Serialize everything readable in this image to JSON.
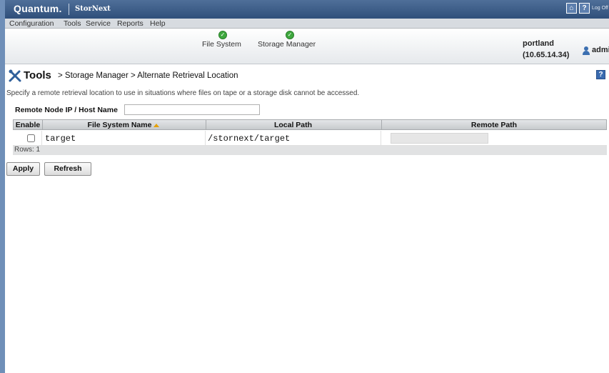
{
  "topbar": {
    "brand": "Quantum.",
    "product": "StorNext",
    "home_icon": "home-icon",
    "help_icon": "help-icon",
    "logoff_label": "Log Off"
  },
  "menu": {
    "items": [
      "Configuration",
      "Tools",
      "Service",
      "Reports",
      "Help"
    ]
  },
  "status": {
    "items": [
      {
        "label": "File System",
        "icon": "check-circle-icon",
        "color": "#3ea83e"
      },
      {
        "label": "Storage Manager",
        "icon": "check-circle-icon",
        "color": "#3ea83e"
      }
    ],
    "host_name": "portland",
    "host_ip": "(10.65.14.34)",
    "user": "admin"
  },
  "page": {
    "title": "Tools",
    "breadcrumb_rest": "> Storage Manager > Alternate Retrieval Location",
    "description": "Specify a remote retrieval location to use in situations where files on tape or a storage disk cannot be accessed.",
    "remote_node_label": "Remote Node IP / Host Name",
    "remote_node_value": ""
  },
  "table": {
    "columns": [
      "Enable",
      "File System Name",
      "Local Path",
      "Remote Path"
    ],
    "sorted_column": "File System Name",
    "rows": [
      {
        "enable": false,
        "file_system_name": "target",
        "local_path": "/stornext/target",
        "remote_path": ""
      }
    ],
    "rows_label": "Rows: 1"
  },
  "buttons": {
    "apply": "Apply",
    "refresh": "Refresh"
  }
}
